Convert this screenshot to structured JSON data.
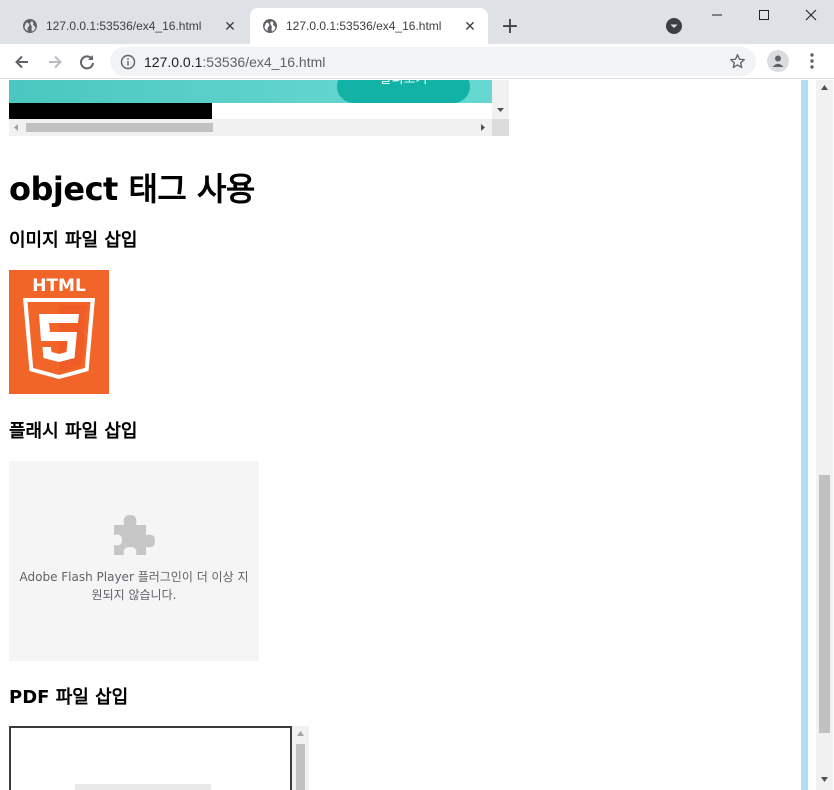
{
  "browser": {
    "tabs": [
      {
        "title": "127.0.0.1:53536/ex4_16.html",
        "active": false
      },
      {
        "title": "127.0.0.1:53536/ex4_16.html",
        "active": true
      }
    ],
    "new_tab_symbol": "+",
    "close_symbol": "✕",
    "address": {
      "host": "127.0.0.1",
      "rest": ":53536/ex4_16.html"
    },
    "icons": [
      "globe-icon",
      "back-icon",
      "forward-icon",
      "reload-icon",
      "info-icon",
      "star-icon",
      "profile-icon",
      "menu-icon",
      "minimize-icon",
      "maximize-icon",
      "close-window-icon",
      "tab-search-icon"
    ]
  },
  "page": {
    "banner_text": "살펴보기",
    "heading": "object 태그 사용",
    "sections": {
      "image": "이미지 파일 삽입",
      "flash": "플래시 파일 삽입",
      "pdf": "PDF 파일 삽입"
    },
    "html5_logo_text": "HTML",
    "flash_message": "Adobe Flash Player 플러그인이 더 이상 지원되지 않습니다."
  },
  "colors": {
    "tabbar": "#dee1e6",
    "teal": "#4ac7c0",
    "html5_orange": "#f16529",
    "scrollbar_blue": "#b5dcf6"
  }
}
